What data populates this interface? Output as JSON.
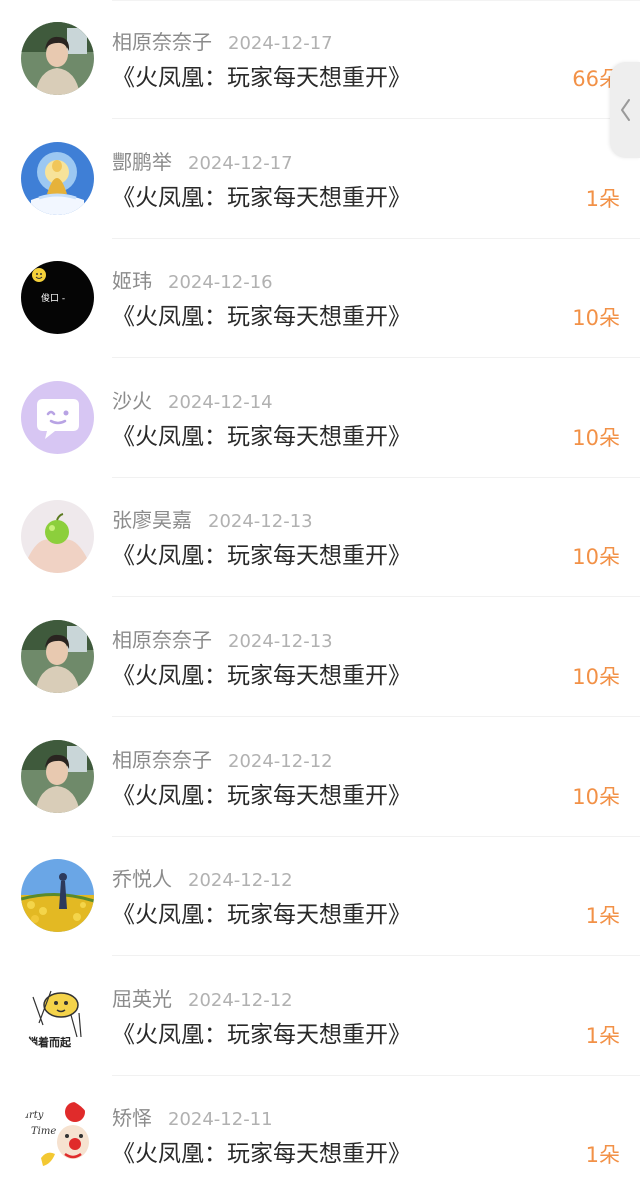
{
  "colors": {
    "amount": "#f29147",
    "name": "#8b8b8b",
    "date": "#b1b1b1",
    "title": "#2a2a2a"
  },
  "side_handle": {
    "icon": "chevron-left-icon"
  },
  "items": [
    {
      "name": "相原奈奈子",
      "date": "2024-12-17",
      "title": "《火凤凰：玩家每天想重开》",
      "amount": "66朵",
      "avatar": "avatar-young-man-photo"
    },
    {
      "name": "酆鹏举",
      "date": "2024-12-17",
      "title": "《火凤凰：玩家每天想重开》",
      "amount": "1朵",
      "avatar": "avatar-golden-buddha"
    },
    {
      "name": "姬玮",
      "date": "2024-12-16",
      "title": "《火凤凰：玩家每天想重开》",
      "amount": "10朵",
      "avatar": "avatar-black-smiley"
    },
    {
      "name": "沙火",
      "date": "2024-12-14",
      "title": "《火凤凰：玩家每天想重开》",
      "amount": "10朵",
      "avatar": "avatar-default-chat-bubble"
    },
    {
      "name": "张廖昊嘉",
      "date": "2024-12-13",
      "title": "《火凤凰：玩家每天想重开》",
      "amount": "10朵",
      "avatar": "avatar-hands-apple"
    },
    {
      "name": "相原奈奈子",
      "date": "2024-12-13",
      "title": "《火凤凰：玩家每天想重开》",
      "amount": "10朵",
      "avatar": "avatar-young-man-photo"
    },
    {
      "name": "相原奈奈子",
      "date": "2024-12-12",
      "title": "《火凤凰：玩家每天想重开》",
      "amount": "10朵",
      "avatar": "avatar-young-man-photo"
    },
    {
      "name": "乔悦人",
      "date": "2024-12-12",
      "title": "《火凤凰：玩家每天想重开》",
      "amount": "1朵",
      "avatar": "avatar-flower-field"
    },
    {
      "name": "屈英光",
      "date": "2024-12-12",
      "title": "《火凤凰：玩家每天想重开》",
      "amount": "1朵",
      "avatar": "avatar-cartoon-sticker"
    },
    {
      "name": "矫怿",
      "date": "2024-12-11",
      "title": "《火凤凰：玩家每天想重开》",
      "amount": "1朵",
      "avatar": "avatar-party-time-clown"
    }
  ]
}
